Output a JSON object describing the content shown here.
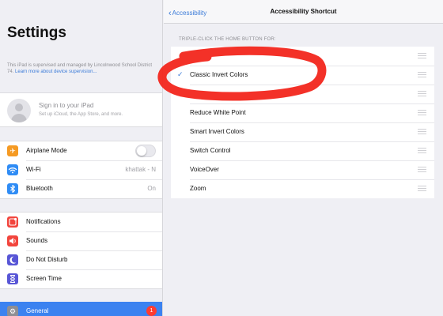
{
  "sidebar": {
    "title": "Settings",
    "supervised_text": "This iPad is supervised and managed by Lincolnwood School District 74.",
    "supervised_link": "Learn more about device supervision...",
    "signin": {
      "title": "Sign in to your iPad",
      "subtitle": "Set up iCloud, the App Store, and more."
    },
    "group1": [
      {
        "label": "Airplane Mode",
        "icon": "airplane-icon",
        "color": "#f59a23",
        "toggle": false
      },
      {
        "label": "Wi-Fi",
        "icon": "wifi-icon",
        "color": "#2f8cf5",
        "value": "khattak - N"
      },
      {
        "label": "Bluetooth",
        "icon": "bluetooth-icon",
        "color": "#2f8cf5",
        "value": "On"
      }
    ],
    "group2": [
      {
        "label": "Notifications",
        "icon": "notifications-icon",
        "color": "#f2453d"
      },
      {
        "label": "Sounds",
        "icon": "sounds-icon",
        "color": "#f2453d"
      },
      {
        "label": "Do Not Disturb",
        "icon": "moon-icon",
        "color": "#5856d6"
      },
      {
        "label": "Screen Time",
        "icon": "hourglass-icon",
        "color": "#5856d6"
      }
    ],
    "general": {
      "label": "General",
      "icon": "gear-icon",
      "badge": "1"
    }
  },
  "navbar": {
    "back_label": "Accessibility",
    "title": "Accessibility Shortcut"
  },
  "section_header": "TRIPLE-CLICK THE HOME BUTTON FOR:",
  "shortcut_options": [
    {
      "label": "",
      "checked": false
    },
    {
      "label": "Classic Invert Colors",
      "checked": true
    },
    {
      "label": "",
      "checked": false
    },
    {
      "label": "Reduce White Point",
      "checked": false
    },
    {
      "label": "Smart Invert Colors",
      "checked": false
    },
    {
      "label": "Switch Control",
      "checked": false
    },
    {
      "label": "VoiceOver",
      "checked": false
    },
    {
      "label": "Zoom",
      "checked": false
    }
  ],
  "colors": {
    "accent": "#3b7bd8",
    "annotation_red": "#f2261c",
    "selected_row": "#3b82f0"
  }
}
